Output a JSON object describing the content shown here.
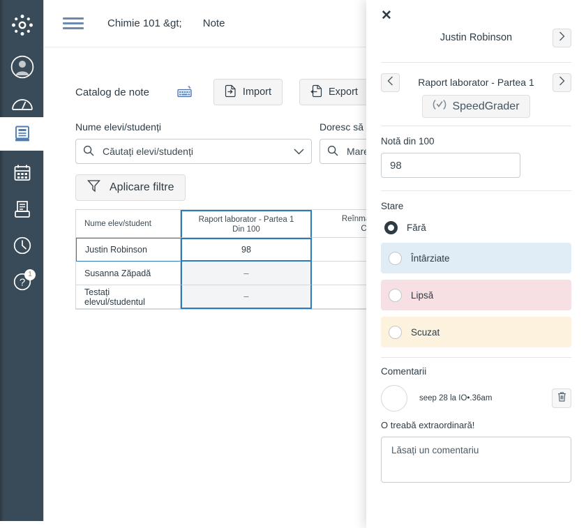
{
  "globalnav": {
    "items": [
      {
        "name": "canvas-logo",
        "icon": "canvas-logo-icon",
        "label": "Canvas"
      },
      {
        "name": "account",
        "icon": "account-icon",
        "label": "Cont"
      },
      {
        "name": "dashboard",
        "icon": "dashboard-icon",
        "label": "Tablou de bord"
      },
      {
        "name": "courses",
        "icon": "courses-book-icon",
        "label": "Cursuri"
      },
      {
        "name": "calendar",
        "icon": "calendar-icon",
        "label": "Calendar"
      },
      {
        "name": "inbox",
        "icon": "inbox-icon",
        "label": "Mesaje primite"
      },
      {
        "name": "history",
        "icon": "clock-history-icon",
        "label": "Istoric"
      },
      {
        "name": "help",
        "icon": "question-help-icon",
        "label": "Ajutor",
        "badge": "1"
      }
    ]
  },
  "topbar": {
    "menu_icon": "hamburger-menu-icon",
    "breadcrumb_course": "Chimie 101 &gt;",
    "breadcrumb_page": "Note"
  },
  "gradebook": {
    "title": "Catalog de note",
    "keyboard_icon": "keyboard-shortcuts-icon",
    "import_label": "Import",
    "export_label": "Export",
    "student_names_label": "Nume elevi/studenți",
    "student_search_placeholder": "Căutați elevi/studenți",
    "assignment_label": "Doresc să primesc o atribuire",
    "assignment_search_value": "Mare",
    "apply_filters_label": "Aplicare filtre",
    "grid": {
      "headers": {
        "student": "Nume elev/student",
        "assignment_title": "Raport laborator - Partea 1",
        "assignment_points": "Din 100",
        "third_title": "Reînmânare",
        "third_points": "C"
      },
      "rows": [
        {
          "student": "Justin Robinson",
          "score": "98",
          "third": ""
        },
        {
          "student": "Susanna Zăpadă",
          "score": "–",
          "third": ""
        },
        {
          "student": "Testați elevul/studentul",
          "score": "–",
          "third": ""
        }
      ]
    }
  },
  "tray": {
    "close_icon": "close-icon",
    "student_name": "Justin  Robinson",
    "prev_student_icon": "chevron-left-icon",
    "next_student_icon": "chevron-right-icon",
    "assignment_name": "Raport laborator - Partea 1",
    "prev_assignment_icon": "chevron-left-icon",
    "next_assignment_icon": "chevron-right-icon",
    "speedgrader_label": "SpeedGrader",
    "speedgrader_icon": "speedgrader-icon",
    "grade_label": "Notă din 100",
    "grade_value": "98",
    "status_label": "Stare",
    "statuses": [
      {
        "label": "Fără",
        "selected": true,
        "color": "#ffffff"
      },
      {
        "label": "Întârziate",
        "selected": false,
        "color": "#e0edf6"
      },
      {
        "label": "Lipsă",
        "selected": false,
        "color": "#f7e0e3"
      },
      {
        "label": "Scuzat",
        "selected": false,
        "color": "#fcf2de"
      }
    ],
    "comments_label": "Comentarii",
    "comment_meta": "seep 28 la IO•.36am",
    "comment_body": "O treabă extraordinară!",
    "comment_delete_icon": "trash-icon",
    "comment_avatar": "avatar",
    "new_comment_placeholder": "Lăsați un comentariu"
  }
}
